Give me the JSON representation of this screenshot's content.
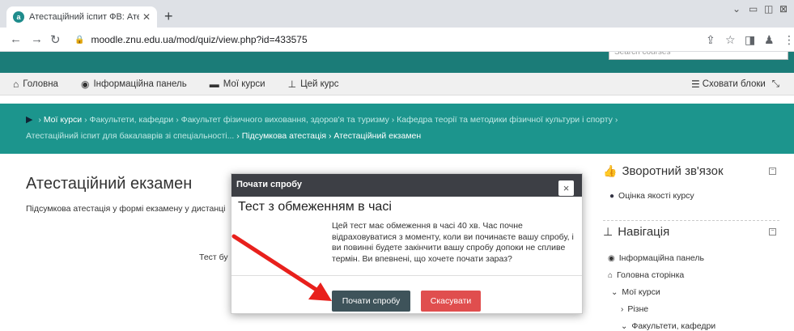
{
  "browser": {
    "tab_title": "Атестаційний іспит ФВ: Атестаці",
    "favicon_letter": "a",
    "url": "moodle.znu.edu.ua/mod/quiz/view.php?id=433575"
  },
  "site": {
    "search_placeholder": "Search courses"
  },
  "navbar": {
    "items": [
      {
        "label": "Головна"
      },
      {
        "label": "Інформаційна панель"
      },
      {
        "label": "Мої курси"
      },
      {
        "label": "Цей курс"
      }
    ],
    "hide_blocks": "Сховати блоки"
  },
  "breadcrumb": {
    "line1": [
      "Мої курси",
      "Факультети, кафедри",
      "Факультет фізичного виховання, здоров'я та туризму",
      "Кафедра теорії та методики фізичної культури і спорту"
    ],
    "line2": [
      "Атестаційний іспит для бакалаврів зі спеціальності...",
      "Підсумкова атестація",
      "Атестаційний екзамен"
    ],
    "sep": "›"
  },
  "main": {
    "title": "Атестаційний екзамен",
    "subtext": "Підсумкова атестація у формі екзамену у дистанці",
    "test_by": "Тест бу"
  },
  "blocks": {
    "feedback": {
      "title": "Зворотний зв'язок",
      "link": "Оцінка якості курсу"
    },
    "navigation": {
      "title": "Навігація",
      "items": [
        "Інформаційна панель",
        "Головна сторінка",
        "Мої курси",
        "Різне",
        "Факультети, кафедри"
      ]
    }
  },
  "modal": {
    "header": "Почати спробу",
    "close": "×",
    "title": "Тест з обмеженням в часі",
    "body": "Цей тест має обмеження в часі 40 хв. Час почне відраховуватися з моменту, коли ви починаєте вашу спробу, і ви повинні будете закінчити вашу спробу допоки не спливе термін. Ви впевнені, що хочете почати зараз?",
    "start_button": "Почати спробу",
    "cancel_button": "Скасувати"
  },
  "colors": {
    "teal_header": "#1b7c78",
    "teal_breadcrumb": "#1c958d",
    "modal_header": "#3d3f45",
    "start_button": "#3e535a",
    "cancel_button": "#e04e4e",
    "annotation_arrow": "#e8201c"
  }
}
